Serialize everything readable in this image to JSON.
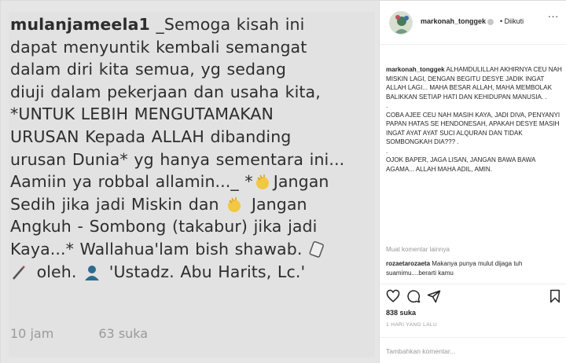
{
  "photo": {
    "username": "mulanjameela1",
    "lines": [
      "_Semoga kisah ini",
      "dapat menyuntik kembali semangat",
      "dalam diri kita semua, yg sedang",
      "diuji dalam pekerjaan dan usaha kita,",
      "*UNTUK LEBIH MENGUTAMAKAN",
      "URUSAN Kepada ALLAH dibanding",
      "urusan Dunia* yg hanya sementara ini...",
      "Aamiin ya robbal allamin..._ *",
      "Jangan",
      "Sedih jika jadi Miskin dan ",
      " Jangan",
      "Angkuh - Sombong (takabur) jika jadi",
      "Kaya...* Wallahua'lam bish shawab. ",
      " oleh. ",
      " 'Ustadz. Abu Harits, Lc.'"
    ],
    "footer_time": "10 jam",
    "footer_likes": "63 suka"
  },
  "header": {
    "username": "markonah_tonggek",
    "follow_status": "• Diikuti"
  },
  "caption": {
    "username": "markonah_tonggek",
    "para1": "ALHAMDULILLAH AKHIRNYA CEU NAH MISKIN LAGI, DENGAN BEGITU DESYE JADIK INGAT ALLAH LAGI... MAHA BESAR ALLAH, MAHA MEMBOLAK BALIKKAN SETIAP HATI DAN KEHIDUPAN MANUSIA. .",
    "dot1": ".",
    "para2": "COBA AJEE CEU NAH MASIH KAYA, JADI DIVA, PENYANYI PAPAN HATAS SE HENDONESAH, APAKAH DESYE MASIH INGAT AYAT AYAT SUCI ALQURAN DAN TIDAK SOMBONGKAH DIA??? .",
    "dot2": ".",
    "para3": "OJOK BAPER, JAGA LISAN, JANGAN BAWA BAWA AGAMA... ALLAH MAHA ADIL, AMIN."
  },
  "more_comments": "Muat komentar lainnya",
  "comment": {
    "username": "rozaetarozaeta",
    "text": "Makanya punya mulut dijaga tuh suamimu....berarti kamu"
  },
  "likes": "838 suka",
  "time_ago": "1 HARI YANG LALU",
  "add_comment_placeholder": "Tambahkan komentar...",
  "more_options": "...",
  "icons": [
    "heart-icon",
    "comment-icon",
    "share-icon",
    "bookmark-icon"
  ]
}
